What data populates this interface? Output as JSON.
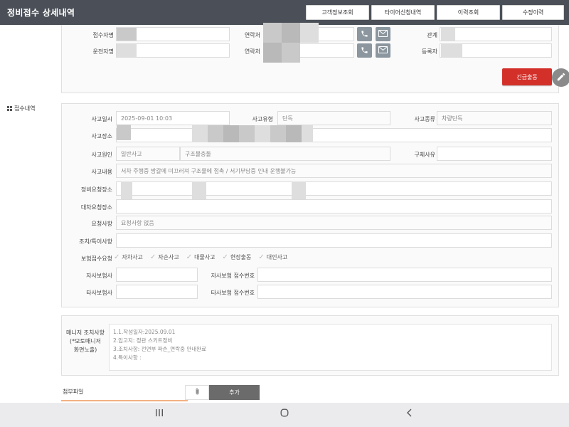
{
  "header": {
    "title": "정비접수 상세내역",
    "buttons": [
      "고객정보조회",
      "타이어신청내역",
      "이력조회",
      "수정이력"
    ]
  },
  "top_section": {
    "receiver_label": "접수자명",
    "contact_label_1": "연락처",
    "relation_label": "관계",
    "driver_label": "운전자명",
    "contact_label_2": "연락처",
    "registrant_label": "등록자",
    "urgent_button": "긴급출동"
  },
  "side": {
    "label": "접수내역"
  },
  "accident": {
    "date_label": "사고일시",
    "date_value": "2025-09-01 10:03",
    "type_label": "사고유형",
    "type_value": "단독",
    "kind_label": "사고종류",
    "kind_value": "차량단독",
    "place_label": "사고장소",
    "cause_label": "사고원인",
    "cause_value_1": "일반사고",
    "cause_value_2": "구조물충돌",
    "recovery_label": "구체사유",
    "content_label": "사고내용",
    "content_value": "서차 주행중 방갈에 미끄러져 구조물에 접촉 / 서기부담중 인내 운행불가능",
    "repair_place_label": "정비요청장소",
    "rental_place_label": "대차요청장소",
    "request_label": "요청사항",
    "request_value": "요청사항 없음",
    "action_label": "조치/특이사항",
    "insurance_label": "보험접수요청",
    "insurance_options": [
      "자차사고",
      "자손사고",
      "대물사고",
      "현장출동",
      "대인사고"
    ],
    "own_insurer_label": "자사보험사",
    "own_claim_label": "자사보험 접수번호",
    "other_insurer_label": "타사보험사",
    "other_claim_label": "타사보험 접수번호"
  },
  "manager_note": {
    "label_lines": [
      "매니저 조치사항",
      "(*모토매니저",
      "화면노출)"
    ],
    "lines": [
      "1.1.작성일자:2025.09.01",
      "2.입고지: 정관 스키트정비",
      "3.조치사항: 전면부 파손_연락중 안내완료",
      "4.특이사항 :"
    ]
  },
  "attachment": {
    "label": "첨부파일",
    "add_button": "추가"
  },
  "icons": {
    "phone": "phone-icon",
    "mail": "mail-icon",
    "pencil": "pencil-icon",
    "paperclip": "paperclip-icon",
    "menu": "recent-apps-icon",
    "home": "home-icon",
    "back": "back-icon"
  },
  "colors": {
    "topbar": "#4b5058",
    "urgent": "#d3302a",
    "accent_line": "#f2b183"
  }
}
